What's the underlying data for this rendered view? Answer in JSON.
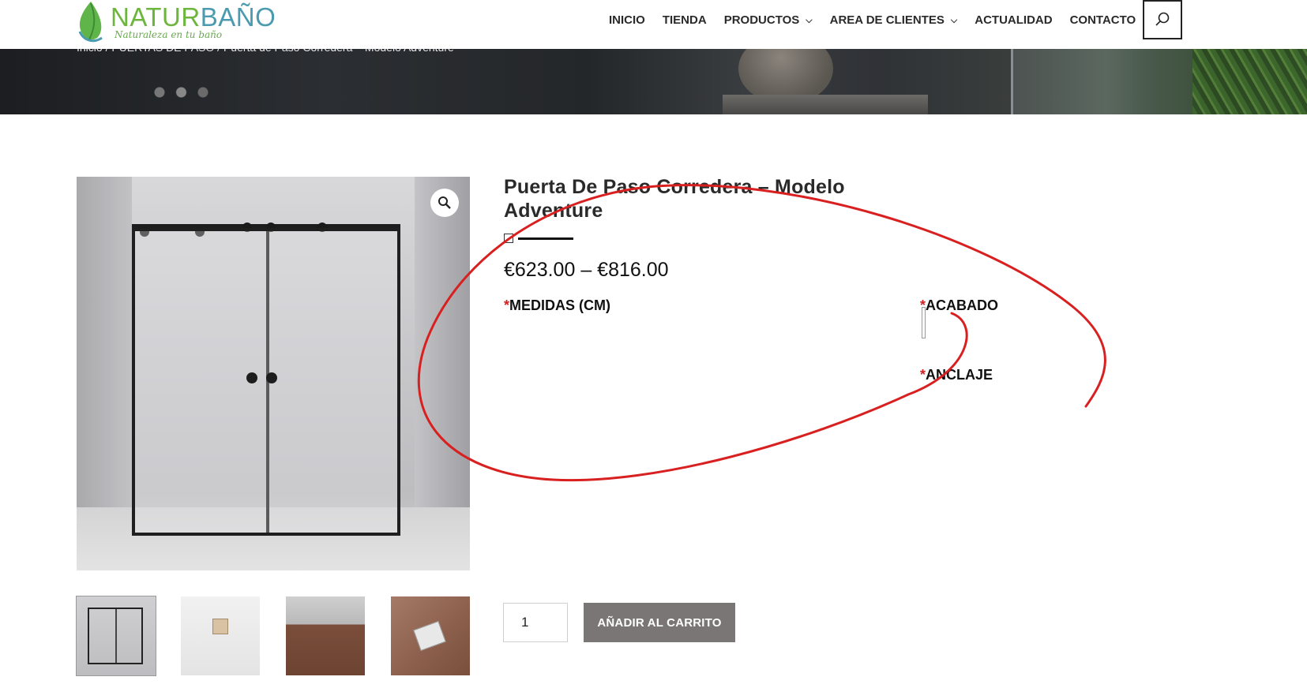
{
  "header": {
    "logo": {
      "brand": "NATURBAÑO",
      "brand_part1": "NATUR",
      "brand_part2": "BAÑO",
      "tagline": "Naturaleza en tu baño"
    },
    "nav": [
      {
        "label": "INICIO",
        "has_dropdown": false
      },
      {
        "label": "TIENDA",
        "has_dropdown": false
      },
      {
        "label": "PRODUCTOS",
        "has_dropdown": true
      },
      {
        "label": "AREA DE CLIENTES",
        "has_dropdown": true
      },
      {
        "label": "ACTUALIDAD",
        "has_dropdown": false
      },
      {
        "label": "CONTACTO",
        "has_dropdown": false
      }
    ],
    "search_icon": "search-icon"
  },
  "breadcrumb": "Inicio / PUERTAS DE PASO / Puerta de Paso Corredera – Modelo Adventure",
  "product": {
    "title": "Puerta De Paso Corredera – Modelo Adventure",
    "price": "€623.00 – €816.00",
    "options": {
      "required_mark": "*",
      "medidas": "MEDIDAS (CM)",
      "acabado": "ACABADO",
      "anclaje": "ANCLAJE"
    },
    "gallery_icon": "zoom-icon",
    "thumbnails": [
      "thumbnail-1",
      "thumbnail-2",
      "thumbnail-3",
      "thumbnail-4"
    ]
  },
  "cart": {
    "quantity": "1",
    "add_to_cart_label": "AÑADIR AL CARRITO"
  },
  "colors": {
    "accent_green": "#6db63d",
    "accent_teal": "#4a9ab0",
    "button_gray": "#7a7676",
    "required_red": "#d32020",
    "annotation_red": "#d92020"
  }
}
